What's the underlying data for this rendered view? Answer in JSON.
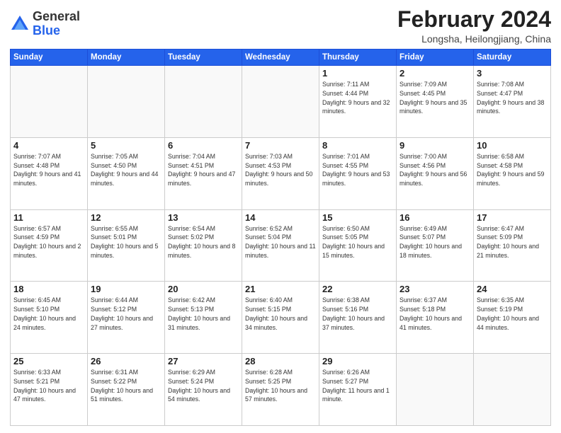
{
  "header": {
    "logo_general": "General",
    "logo_blue": "Blue",
    "month_year": "February 2024",
    "location": "Longsha, Heilongjiang, China"
  },
  "days_of_week": [
    "Sunday",
    "Monday",
    "Tuesday",
    "Wednesday",
    "Thursday",
    "Friday",
    "Saturday"
  ],
  "weeks": [
    [
      {
        "day": "",
        "empty": true
      },
      {
        "day": "",
        "empty": true
      },
      {
        "day": "",
        "empty": true
      },
      {
        "day": "",
        "empty": true
      },
      {
        "day": "1",
        "sunrise": "7:11 AM",
        "sunset": "4:44 PM",
        "daylight": "9 hours and 32 minutes."
      },
      {
        "day": "2",
        "sunrise": "7:09 AM",
        "sunset": "4:45 PM",
        "daylight": "9 hours and 35 minutes."
      },
      {
        "day": "3",
        "sunrise": "7:08 AM",
        "sunset": "4:47 PM",
        "daylight": "9 hours and 38 minutes."
      }
    ],
    [
      {
        "day": "4",
        "sunrise": "7:07 AM",
        "sunset": "4:48 PM",
        "daylight": "9 hours and 41 minutes."
      },
      {
        "day": "5",
        "sunrise": "7:05 AM",
        "sunset": "4:50 PM",
        "daylight": "9 hours and 44 minutes."
      },
      {
        "day": "6",
        "sunrise": "7:04 AM",
        "sunset": "4:51 PM",
        "daylight": "9 hours and 47 minutes."
      },
      {
        "day": "7",
        "sunrise": "7:03 AM",
        "sunset": "4:53 PM",
        "daylight": "9 hours and 50 minutes."
      },
      {
        "day": "8",
        "sunrise": "7:01 AM",
        "sunset": "4:55 PM",
        "daylight": "9 hours and 53 minutes."
      },
      {
        "day": "9",
        "sunrise": "7:00 AM",
        "sunset": "4:56 PM",
        "daylight": "9 hours and 56 minutes."
      },
      {
        "day": "10",
        "sunrise": "6:58 AM",
        "sunset": "4:58 PM",
        "daylight": "9 hours and 59 minutes."
      }
    ],
    [
      {
        "day": "11",
        "sunrise": "6:57 AM",
        "sunset": "4:59 PM",
        "daylight": "10 hours and 2 minutes."
      },
      {
        "day": "12",
        "sunrise": "6:55 AM",
        "sunset": "5:01 PM",
        "daylight": "10 hours and 5 minutes."
      },
      {
        "day": "13",
        "sunrise": "6:54 AM",
        "sunset": "5:02 PM",
        "daylight": "10 hours and 8 minutes."
      },
      {
        "day": "14",
        "sunrise": "6:52 AM",
        "sunset": "5:04 PM",
        "daylight": "10 hours and 11 minutes."
      },
      {
        "day": "15",
        "sunrise": "6:50 AM",
        "sunset": "5:05 PM",
        "daylight": "10 hours and 15 minutes."
      },
      {
        "day": "16",
        "sunrise": "6:49 AM",
        "sunset": "5:07 PM",
        "daylight": "10 hours and 18 minutes."
      },
      {
        "day": "17",
        "sunrise": "6:47 AM",
        "sunset": "5:09 PM",
        "daylight": "10 hours and 21 minutes."
      }
    ],
    [
      {
        "day": "18",
        "sunrise": "6:45 AM",
        "sunset": "5:10 PM",
        "daylight": "10 hours and 24 minutes."
      },
      {
        "day": "19",
        "sunrise": "6:44 AM",
        "sunset": "5:12 PM",
        "daylight": "10 hours and 27 minutes."
      },
      {
        "day": "20",
        "sunrise": "6:42 AM",
        "sunset": "5:13 PM",
        "daylight": "10 hours and 31 minutes."
      },
      {
        "day": "21",
        "sunrise": "6:40 AM",
        "sunset": "5:15 PM",
        "daylight": "10 hours and 34 minutes."
      },
      {
        "day": "22",
        "sunrise": "6:38 AM",
        "sunset": "5:16 PM",
        "daylight": "10 hours and 37 minutes."
      },
      {
        "day": "23",
        "sunrise": "6:37 AM",
        "sunset": "5:18 PM",
        "daylight": "10 hours and 41 minutes."
      },
      {
        "day": "24",
        "sunrise": "6:35 AM",
        "sunset": "5:19 PM",
        "daylight": "10 hours and 44 minutes."
      }
    ],
    [
      {
        "day": "25",
        "sunrise": "6:33 AM",
        "sunset": "5:21 PM",
        "daylight": "10 hours and 47 minutes."
      },
      {
        "day": "26",
        "sunrise": "6:31 AM",
        "sunset": "5:22 PM",
        "daylight": "10 hours and 51 minutes."
      },
      {
        "day": "27",
        "sunrise": "6:29 AM",
        "sunset": "5:24 PM",
        "daylight": "10 hours and 54 minutes."
      },
      {
        "day": "28",
        "sunrise": "6:28 AM",
        "sunset": "5:25 PM",
        "daylight": "10 hours and 57 minutes."
      },
      {
        "day": "29",
        "sunrise": "6:26 AM",
        "sunset": "5:27 PM",
        "daylight": "11 hours and 1 minute."
      },
      {
        "day": "",
        "empty": true
      },
      {
        "day": "",
        "empty": true
      }
    ]
  ]
}
